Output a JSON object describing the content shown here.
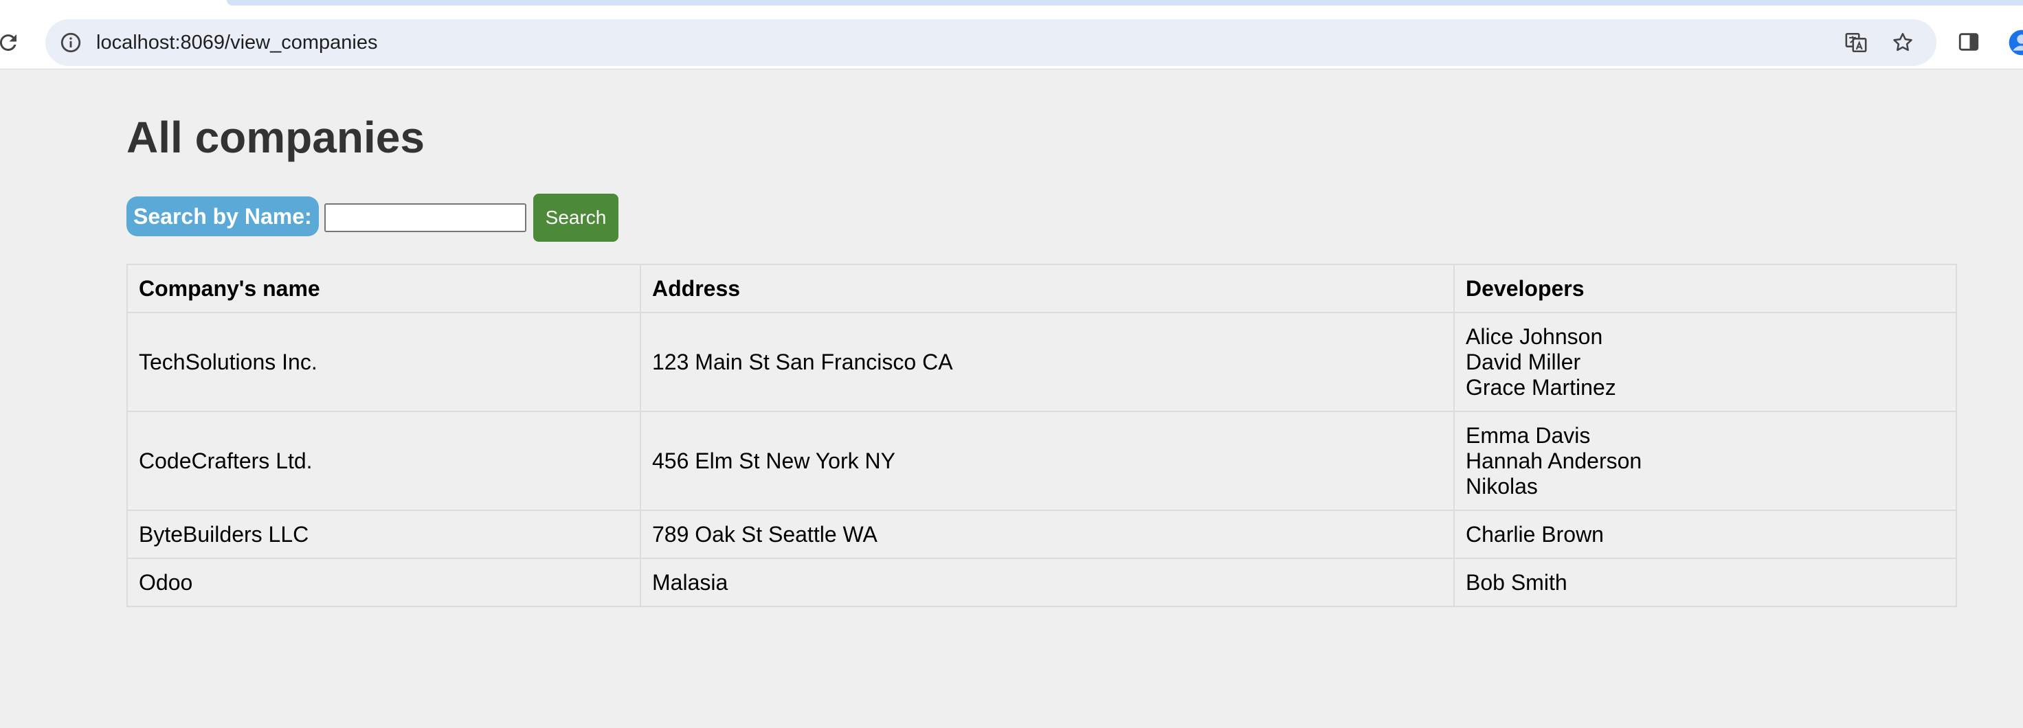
{
  "browser": {
    "url": "localhost:8069/view_companies"
  },
  "page": {
    "title": "All companies",
    "search": {
      "label": "Search by Name:",
      "value": "",
      "button_label": "Search"
    },
    "table": {
      "headers": [
        "Company's name",
        "Address",
        "Developers"
      ],
      "rows": [
        {
          "name": "TechSolutions Inc.",
          "address": "123 Main St San Francisco CA",
          "developers": [
            "Alice Johnson",
            "David Miller",
            "Grace Martinez"
          ]
        },
        {
          "name": "CodeCrafters Ltd.",
          "address": "456 Elm St New York NY",
          "developers": [
            "Emma Davis",
            "Hannah Anderson",
            "Nikolas"
          ]
        },
        {
          "name": "ByteBuilders LLC",
          "address": "789 Oak St Seattle WA",
          "developers": [
            "Charlie Brown"
          ]
        },
        {
          "name": "Odoo",
          "address": "Malasia",
          "developers": [
            "Bob Smith"
          ]
        }
      ]
    }
  },
  "colors": {
    "page_background": "#efefef",
    "search_label_bg": "#5aa9d6",
    "search_button_bg": "#4c8a3a",
    "omnibox_bg": "#eaeef7"
  },
  "icons": {
    "reload": "reload-icon",
    "site_info": "info-icon",
    "translate": "translate-icon",
    "bookmark": "star-icon",
    "side_panel": "side-panel-icon",
    "profile": "profile-icon"
  }
}
